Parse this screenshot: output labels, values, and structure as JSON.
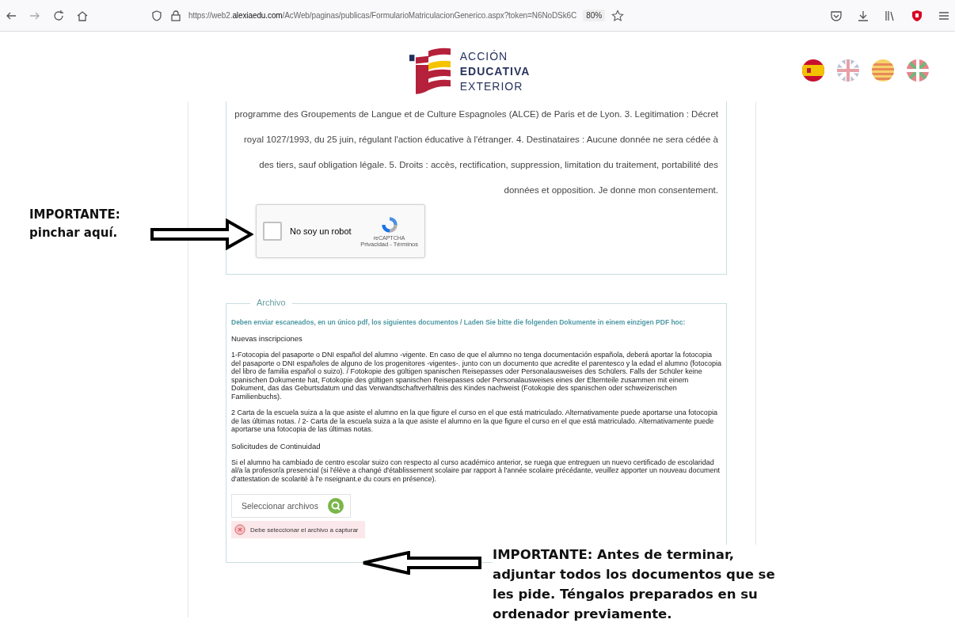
{
  "browser": {
    "url": "https://web2.**alexiaedu.com**/AcWeb/paginas/publicas/FormularioMatriculacionGenerico.aspx?token=N6NoDSk6C",
    "zoom": "80%"
  },
  "header": {
    "logo_lines": [
      "ACCIÓN",
      "EDUCATIVA",
      "EXTERIOR"
    ]
  },
  "consent": {
    "text": "programme des Groupements de Langue et de Culture Espagnoles (ALCE) de Paris et de Lyon. 3. Legitimation : Décret royal 1027/1993, du 25 juin, régulant l'action éducative à l'étranger. 4. Destinataires : Aucune donnée ne sera cédée à des tiers, sauf obligation légale. 5. Droits : accès, rectification, suppression, limitation du traitement, portabilité des données et opposition. Je donne mon consentement.",
    "captcha": {
      "label": "No soy un robot",
      "checked": false,
      "brand": "reCAPTCHA",
      "links": "Privacidad - Términos"
    }
  },
  "archive": {
    "legend": "Archivo",
    "intro": "Deben enviar escaneados, en un único pdf, los siguientes documentos / Laden Sie bitte die folgenden Dokumente in einem einzigen PDF hoc:",
    "blocks": [
      {
        "kind": "heading",
        "text": "Nuevas inscripciones"
      },
      {
        "kind": "paragraph",
        "text": "1-Fotocopia del pasaporte o DNI español del alumno -vigente. En caso de que el alumno no tenga documentación española, deberá aportar la fotocopia del pasaporte o DNI españoles de alguno de los progenitores -vigentes-. junto con un documento que acredite el parentesco y la edad el alumno (fotocopia del libro de familia español o suizo). / Fotokopie des gültigen spanischen Reisepasses oder Personalausweises des Schülers. Falls der Schüler keine spanischen Dokumente hat, Fotokopie des gültigen spanischen Reisepasses oder Personalausweises eines der Elternteile zusammen mit einem Dokument, das das Geburtsdatum und das Verwandtschaftverhältnis des Kindes nachweist (Fotokopie des spanischen oder schweizerischen Familienbuchs)."
      },
      {
        "kind": "paragraph",
        "text": "2 Carta de la escuela suiza a la que asiste el alumno en la que figure el curso en el que está matriculado. Alternativamente puede aportarse una fotocopia de las últimas notas. / 2- Carta de la escuela suiza a la que asiste el alumno en la que figure el curso en el que está matriculado. Alternativamente puede aportarse una fotocopia de las últimas notas."
      },
      {
        "kind": "heading",
        "text": "Solicitudes de Continuidad"
      },
      {
        "kind": "paragraph",
        "text": "Si el alumno ha cambiado de centro escolar suizo con respecto al curso académico anterior, se ruega que entreguen un nuevo certificado de escolaridad al/a la profesor/a presencial (si l'élève a changé d'établissement scolaire par rapport à l'année scolaire précédante, veuillez apporter un nouveau document d'attestation de scolarité à l'e nseignant.e du cours en présence)."
      }
    ],
    "upload_button": "Seleccionar archivos",
    "error": "Debe seleccionar el archivo a capturar"
  },
  "annotations": [
    {
      "kind": "left",
      "text": "IMPORTANTE: pinchar aquí."
    },
    {
      "kind": "bottom",
      "text": "IMPORTANTE: Antes de terminar, adjuntar todos los documentos que se les pide. Téngalos preparados en su ordenador previamente."
    }
  ]
}
